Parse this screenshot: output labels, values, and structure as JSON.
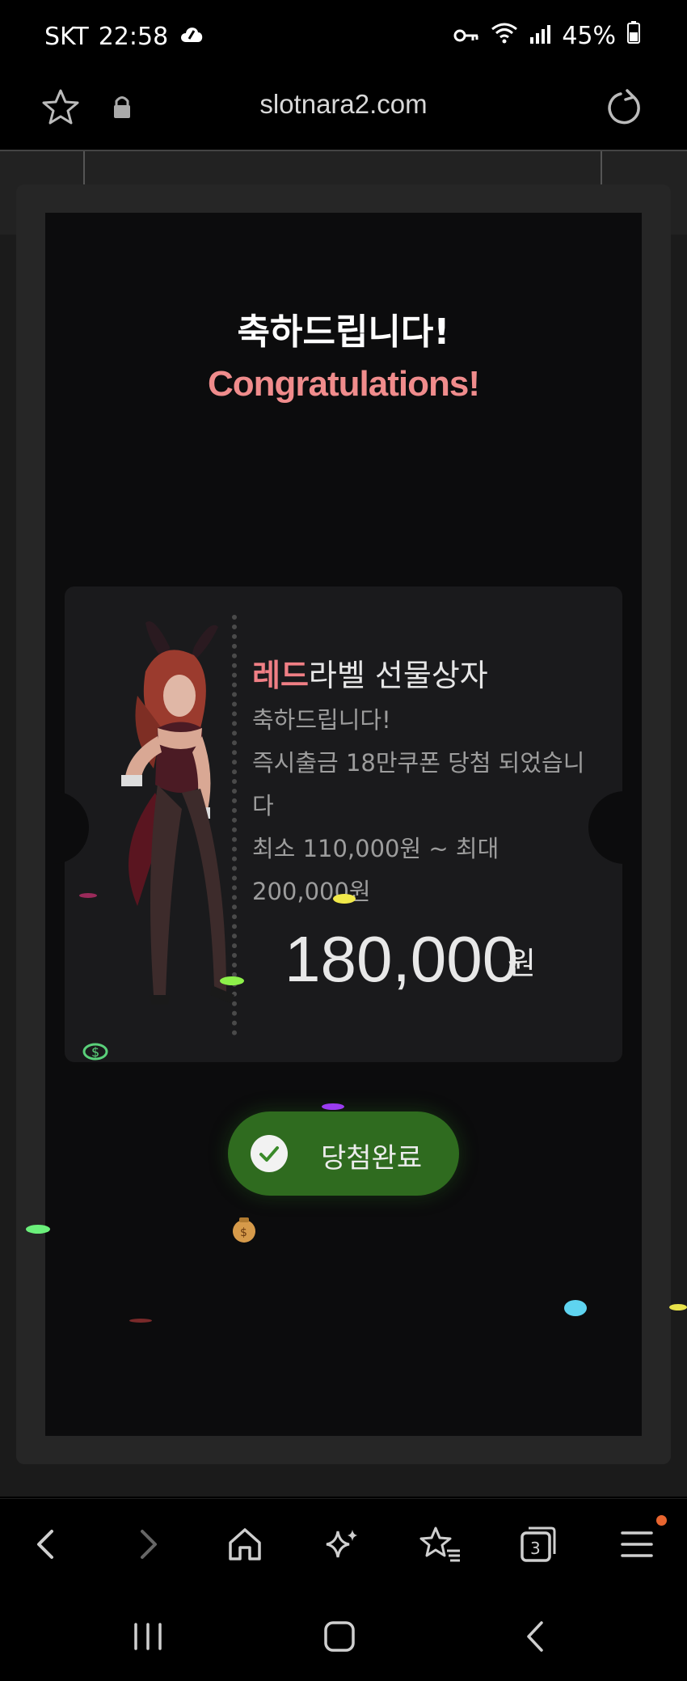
{
  "status_bar": {
    "carrier": "SKT",
    "time": "22:58",
    "battery": "45%"
  },
  "browser": {
    "url": "slotnara2.com",
    "icons": [
      "star-icon",
      "lock-icon",
      "reload-icon"
    ]
  },
  "modal": {
    "title_ko": "축하드립니다!",
    "title_en": "Congratulations!",
    "card": {
      "title_red": "레드",
      "title_rest": "라벨 선물상자",
      "line1": "축하드립니다!",
      "line2": "즉시출금 18만쿠폰 당첨 되었습니다",
      "line3": "최소 110,000원 ~ 최대 200,000원",
      "amount": "180,000",
      "amount_unit": "원"
    },
    "button_label": "당첨완료"
  },
  "bottom_toolbar": {
    "tabs_count": "3",
    "icons": [
      "back-icon",
      "forward-icon",
      "home-icon",
      "sparkle-icon",
      "bookmarks-icon",
      "tabs-icon",
      "menu-icon"
    ]
  },
  "colors": {
    "accent_red": "#f08c8c",
    "button_green": "#2f6b1f"
  }
}
